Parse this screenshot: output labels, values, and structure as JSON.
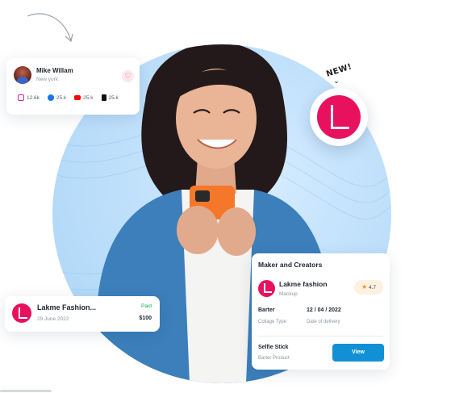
{
  "profile": {
    "name": "Mike Willam",
    "location": "New york",
    "stats": [
      {
        "icon": "instagram-icon",
        "color": "#d6249f",
        "value": "12.6k"
      },
      {
        "icon": "facebook-icon",
        "color": "#1877f2",
        "value": "25.k"
      },
      {
        "icon": "youtube-icon",
        "color": "#ff0000",
        "value": "25.k"
      },
      {
        "icon": "tiktok-icon",
        "color": "#111111",
        "value": "25.k"
      }
    ]
  },
  "badge": {
    "new_label": "NEW!"
  },
  "order_card": {
    "title": "Lakme Fashion...",
    "date": "29 June 2022",
    "status": "Paid",
    "status_color": "#1ca84d",
    "price": "$100"
  },
  "maker_card": {
    "heading": "Maker and Creators",
    "brand": "Lakme fashion",
    "brand_sub": "Mackup",
    "rating": "4.7",
    "collab_type_value": "Barter",
    "collab_type_label": "Collage Type",
    "delivery_value": "12 / 04 / 2022",
    "delivery_label": "Date of delivery",
    "product_value": "Selfie Stick",
    "product_label": "Barter Product",
    "view_label": "View"
  },
  "colors": {
    "brand": "#e8115e",
    "accent": "#1290d6"
  }
}
